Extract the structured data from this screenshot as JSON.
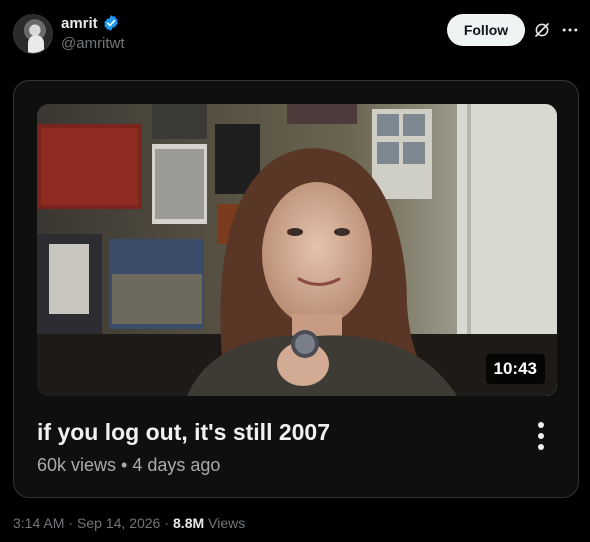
{
  "author": {
    "display_name": "amrit",
    "handle": "@amritwt",
    "verified": true
  },
  "actions": {
    "follow_label": "Follow",
    "grok_icon": "grok-icon",
    "more_icon": "more-icon"
  },
  "video": {
    "title": "if you log out, it's still 2007",
    "meta": "60k views • 4 days ago",
    "duration": "10:43"
  },
  "post": {
    "time": "3:14 AM",
    "date": "Sep 14, 2026",
    "views_count": "8.8M",
    "views_label": "Views",
    "separator": "·"
  },
  "colors": {
    "verified_badge": "#1d9bf0",
    "follow_bg": "#eff3f4",
    "muted_text": "#71767b"
  }
}
